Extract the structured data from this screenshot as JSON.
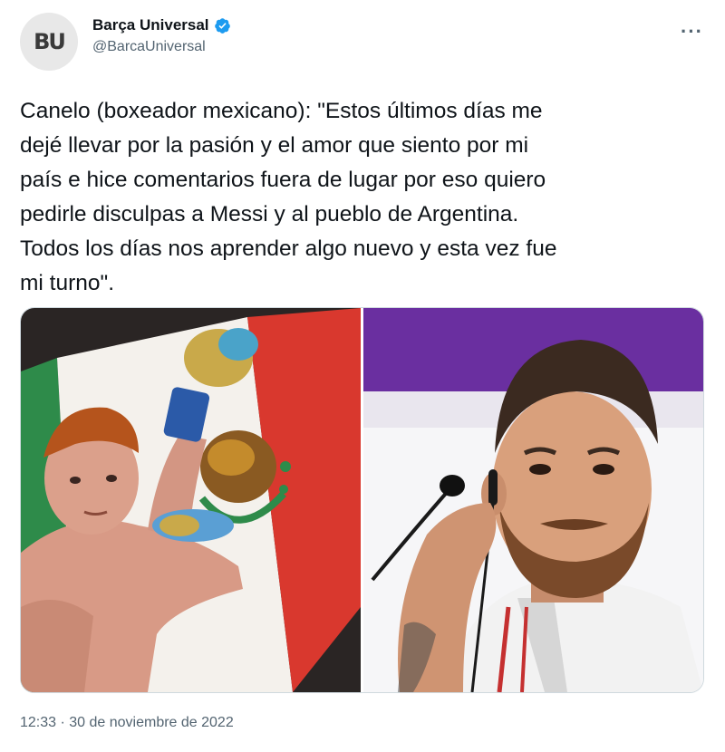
{
  "author": {
    "avatar_initials": "BU",
    "name": "Barça Universal",
    "handle": "@BarcaUniversal",
    "verified": true,
    "verified_icon": "verified-badge-icon",
    "more_label": "···"
  },
  "tweet": {
    "text": "Canelo (boxeador mexicano): \"Estos últimos días me\ndejé llevar por la pasión y el amor que siento por mi\npaís e hice comentarios fuera de lugar por eso quiero\npedirle disculpas a Messi y al pueblo de Argentina.\nTodos los días nos aprender algo nuevo y esta vez fue\nmi turno\".",
    "timestamp": "12:33 · 30 de noviembre de 2022"
  },
  "media": {
    "photos": [
      {
        "subject": "boxer-with-mexican-flag"
      },
      {
        "subject": "footballer-press-conference"
      }
    ]
  },
  "colors": {
    "text": "#0f1419",
    "secondary": "#536471",
    "verified": "#1d9bf0",
    "flag_green": "#2e8b4a",
    "flag_red": "#d9382e",
    "purple_backdrop": "#6a2fa0"
  }
}
